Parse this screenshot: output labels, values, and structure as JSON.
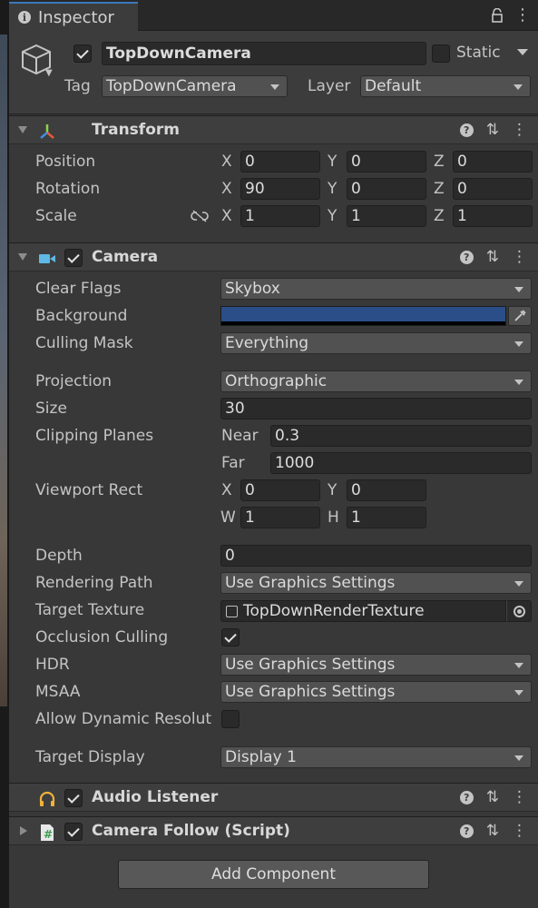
{
  "tab": {
    "title": "Inspector"
  },
  "gameobject": {
    "name": "TopDownCamera",
    "static_label": "Static",
    "tag_label": "Tag",
    "tag_value": "TopDownCamera",
    "layer_label": "Layer",
    "layer_value": "Default"
  },
  "transform": {
    "title": "Transform",
    "position_label": "Position",
    "rotation_label": "Rotation",
    "scale_label": "Scale",
    "axes": {
      "x": "X",
      "y": "Y",
      "z": "Z"
    },
    "position": {
      "x": "0",
      "y": "0",
      "z": "0"
    },
    "rotation": {
      "x": "90",
      "y": "0",
      "z": "0"
    },
    "scale": {
      "x": "1",
      "y": "1",
      "z": "1"
    }
  },
  "camera": {
    "title": "Camera",
    "clear_flags_label": "Clear Flags",
    "clear_flags": "Skybox",
    "background_label": "Background",
    "background_color": "#2b4e88",
    "culling_mask_label": "Culling Mask",
    "culling_mask": "Everything",
    "projection_label": "Projection",
    "projection": "Orthographic",
    "size_label": "Size",
    "size": "30",
    "clipping_label": "Clipping Planes",
    "near_label": "Near",
    "near": "0.3",
    "far_label": "Far",
    "far": "1000",
    "viewport_label": "Viewport Rect",
    "viewport": {
      "x_label": "X",
      "x": "0",
      "y_label": "Y",
      "y": "0",
      "w_label": "W",
      "w": "1",
      "h_label": "H",
      "h": "1"
    },
    "depth_label": "Depth",
    "depth": "0",
    "rendering_path_label": "Rendering Path",
    "rendering_path": "Use Graphics Settings",
    "target_texture_label": "Target Texture",
    "target_texture": "TopDownRenderTexture",
    "occlusion_label": "Occlusion Culling",
    "hdr_label": "HDR",
    "hdr": "Use Graphics Settings",
    "msaa_label": "MSAA",
    "msaa": "Use Graphics Settings",
    "dynamic_res_label": "Allow Dynamic Resolut",
    "target_display_label": "Target Display",
    "target_display": "Display 1"
  },
  "audio_listener": {
    "title": "Audio Listener"
  },
  "camera_follow": {
    "title": "Camera Follow (Script)"
  },
  "add_component": "Add Component"
}
